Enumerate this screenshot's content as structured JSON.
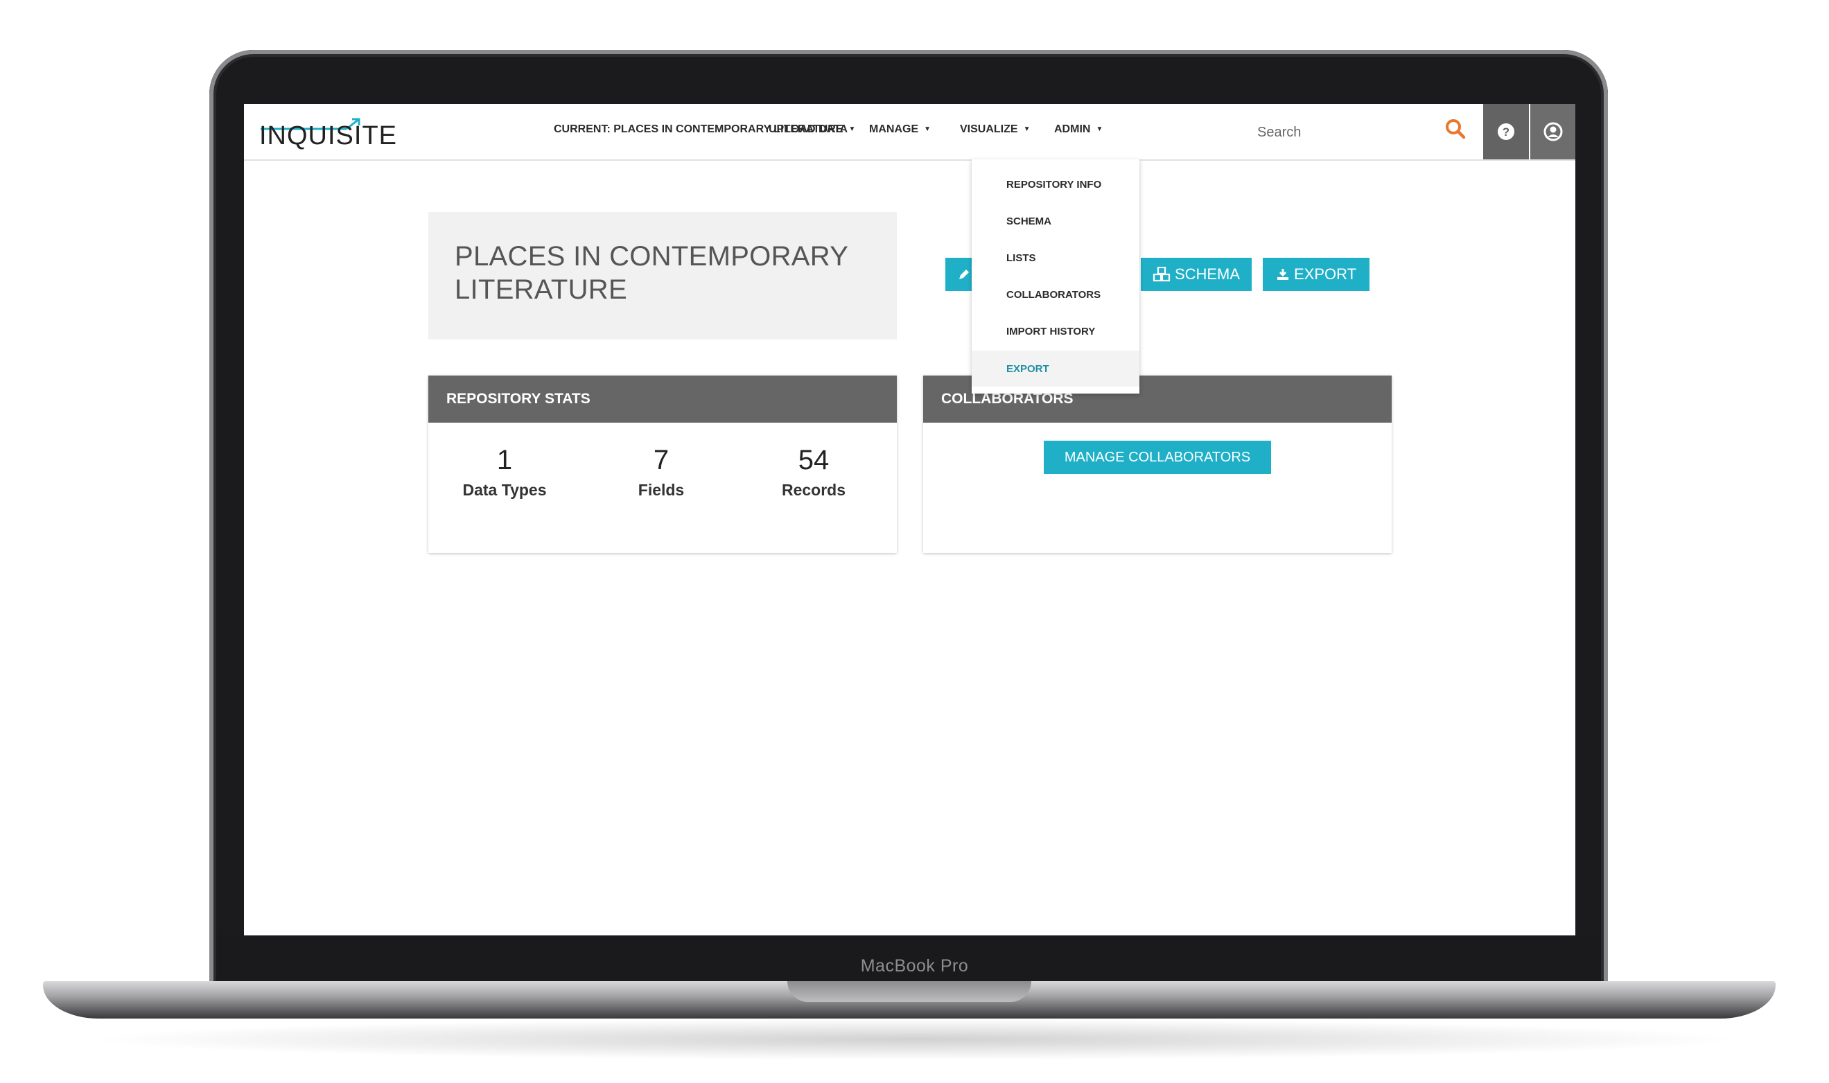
{
  "device": {
    "label": "MacBook Pro"
  },
  "app": {
    "logo_text": "INQUISITE"
  },
  "nav": {
    "current": "CURRENT: PLACES IN CONTEMPORARY LITERATURE",
    "upload": "UPLOAD DATA",
    "manage": "MANAGE",
    "visualize": "VISUALIZE",
    "admin": "ADMIN",
    "search_placeholder": "Search",
    "search_icon": "search-icon",
    "help_icon": "help-icon",
    "user_icon": "user-icon"
  },
  "manage_menu": {
    "items": [
      "REPOSITORY INFO",
      "SCHEMA",
      "LISTS",
      "COLLABORATORS",
      "IMPORT HISTORY",
      "EXPORT"
    ],
    "active": "EXPORT"
  },
  "repository": {
    "title": "PLACES IN CONTEMPORARY LITERATURE"
  },
  "actions": {
    "schema_label": "SCHEMA",
    "export_label": "EXPORT"
  },
  "stats": {
    "header": "REPOSITORY STATS",
    "items": [
      {
        "value": "1",
        "label": "Data Types"
      },
      {
        "value": "7",
        "label": "Fields"
      },
      {
        "value": "54",
        "label": "Records"
      }
    ]
  },
  "collaborators": {
    "header": "COLLABORATORS",
    "button": "MANAGE COLLABORATORS"
  },
  "colors": {
    "accent": "#1fb0c8",
    "panel_header": "#666666",
    "search_icon": "#e8772e",
    "active_menu_text": "#1f8fa3"
  }
}
